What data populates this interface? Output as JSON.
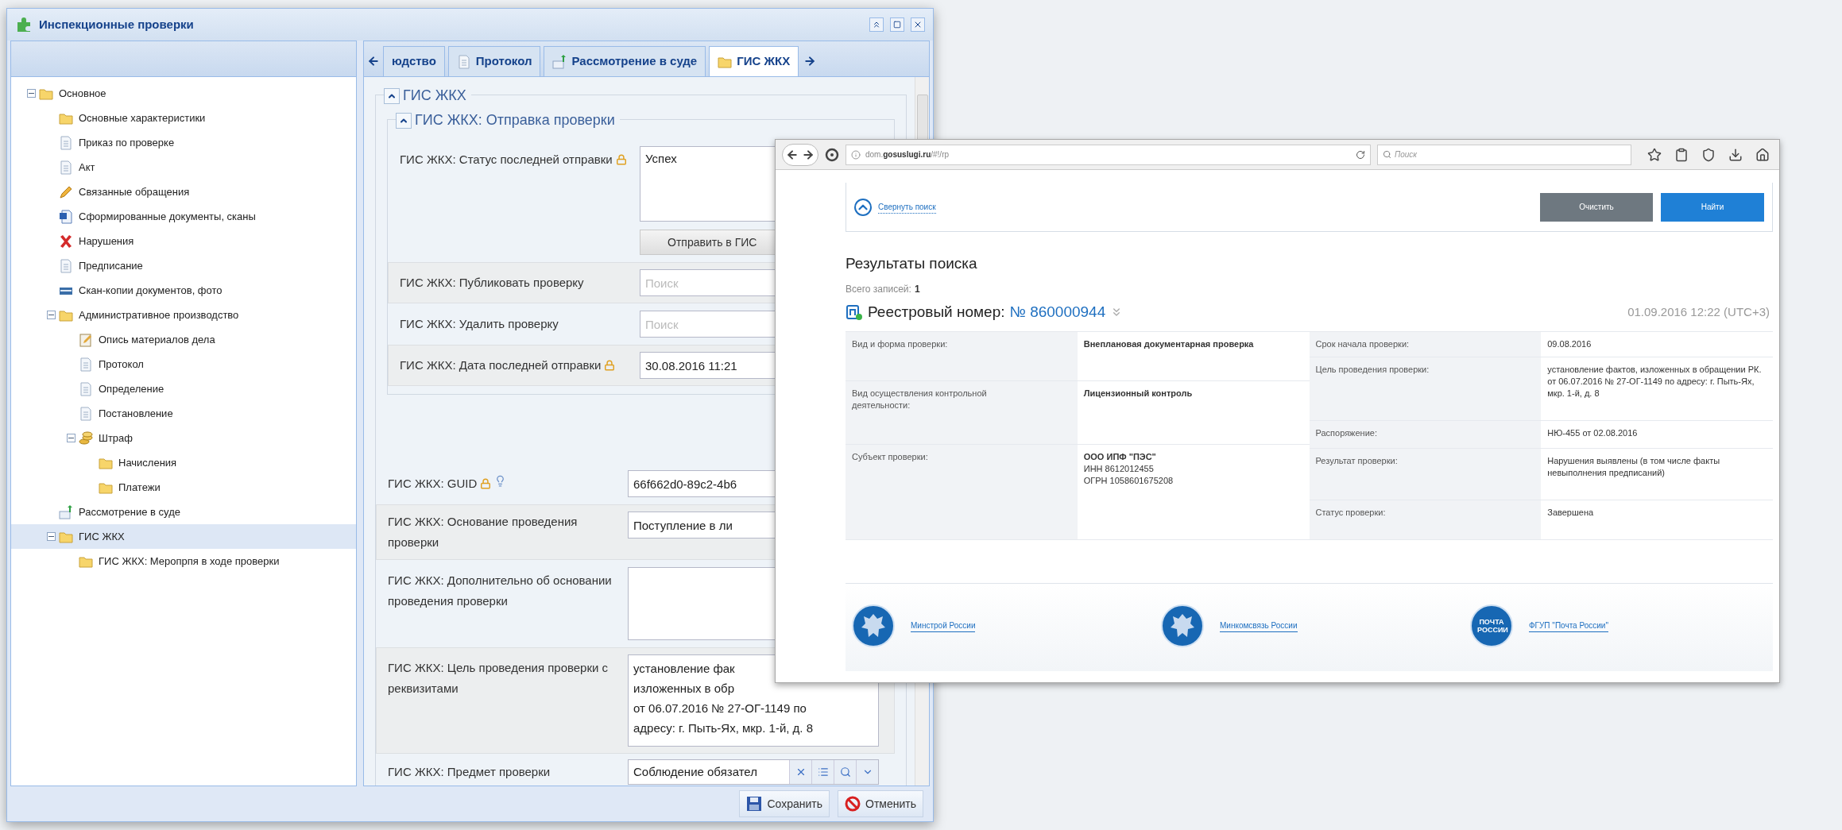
{
  "left_window": {
    "title": "Инспекционные проверки",
    "tree": [
      {
        "label": "Основное",
        "kind": "folder",
        "expanded": true,
        "selected": false,
        "children": [
          {
            "label": "Основные характеристики",
            "kind": "folder",
            "selected": false
          },
          {
            "label": "Приказ по проверке",
            "kind": "doc",
            "selected": false
          },
          {
            "label": "Акт",
            "kind": "doc",
            "selected": false
          },
          {
            "label": "Связанные обращения",
            "kind": "pencil",
            "selected": false
          },
          {
            "label": "Сформированные документы, сканы",
            "kind": "word",
            "selected": false
          },
          {
            "label": "Нарушения",
            "kind": "cross",
            "selected": false
          },
          {
            "label": "Предписание",
            "kind": "doc",
            "selected": false
          },
          {
            "label": "Скан-копии документов, фото",
            "kind": "scan",
            "selected": false
          },
          {
            "label": "Административное производство",
            "kind": "folder",
            "expanded": true,
            "selected": false,
            "children": [
              {
                "label": "Опись материалов дела",
                "kind": "edit",
                "selected": false
              },
              {
                "label": "Протокол",
                "kind": "doc",
                "selected": false
              },
              {
                "label": "Определение",
                "kind": "doc",
                "selected": false
              },
              {
                "label": "Постановление",
                "kind": "doc",
                "selected": false
              },
              {
                "label": "Штраф",
                "kind": "coins",
                "expanded": true,
                "selected": false,
                "children": [
                  {
                    "label": "Начисления",
                    "kind": "folder",
                    "selected": false
                  },
                  {
                    "label": "Платежи",
                    "kind": "folder",
                    "selected": false
                  }
                ]
              }
            ]
          },
          {
            "label": "Рассмотрение в суде",
            "kind": "upload",
            "selected": false
          },
          {
            "label": "ГИС ЖКХ",
            "kind": "folder",
            "expanded": true,
            "selected": true,
            "children": [
              {
                "label": "ГИС ЖКХ: Меропрпя в ходе проверки",
                "kind": "folder",
                "selected": false
              }
            ]
          }
        ]
      }
    ],
    "tabs": [
      {
        "label": "юдство",
        "kind": "plain",
        "selected": false
      },
      {
        "label": "Протокол",
        "kind": "doc",
        "selected": false
      },
      {
        "label": "Рассмотрение в суде",
        "kind": "upload",
        "selected": false
      },
      {
        "label": "ГИС ЖКХ",
        "kind": "folder",
        "selected": true
      }
    ],
    "section_title": "ГИС ЖКХ",
    "subsection_title": "ГИС ЖКХ: Отправка проверки",
    "subsection_fields": [
      {
        "label": "ГИС ЖКХ: Статус последней отправки",
        "locked": true,
        "hint": false,
        "kind": "textarea",
        "value": "Успех",
        "action": "Отправить в ГИС"
      },
      {
        "label": "ГИС ЖКХ: Публиковать проверку",
        "locked": false,
        "hint": false,
        "kind": "search",
        "placeholder": "Поиск"
      },
      {
        "label": "ГИС ЖКХ: Удалить проверку",
        "locked": false,
        "hint": false,
        "kind": "search",
        "placeholder": "Поиск"
      },
      {
        "label": "ГИС ЖКХ: Дата последней отправки",
        "locked": true,
        "hint": false,
        "kind": "text",
        "value": "30.08.2016 11:21"
      }
    ],
    "fields": [
      {
        "label": "ГИС ЖКХ: GUID",
        "locked": true,
        "hint": true,
        "kind": "text",
        "value": "66f662d0-89c2-4b6"
      },
      {
        "label": "ГИС ЖКХ: Основание проведения проверки",
        "locked": false,
        "hint": false,
        "kind": "text",
        "value": "Поступление в ли"
      },
      {
        "label": "ГИС ЖКХ: Дополнительно об основании проведения проверки",
        "locked": false,
        "hint": false,
        "kind": "textarea"
      },
      {
        "label": "ГИС ЖКХ: Цель проведения проверки с реквизитами",
        "locked": false,
        "hint": false,
        "kind": "lines",
        "lines": [
          "установление фак",
          "изложенных в обр",
          "от 06.07.2016 № 27-ОГ-1149 по",
          "адресу: г. Пыть-Ях, мкр. 1-й, д. 8"
        ]
      },
      {
        "label": "ГИС ЖКХ: Предмет проверки",
        "locked": false,
        "hint": false,
        "kind": "combo",
        "value": "Соблюдение обязател"
      }
    ],
    "buttons": [
      {
        "label": "Сохранить",
        "kind": "save"
      },
      {
        "label": "Отменить",
        "kind": "cancel"
      }
    ]
  },
  "browser": {
    "url_host": "dom.",
    "url_domain": "gosuslugi.ru",
    "url_path": "/#!/rp",
    "search_placeholder": "Поиск",
    "collapse_link": "Свернуть поиск",
    "clear_button": "Очистить",
    "find_button": "Найти",
    "results_title": "Результаты поиска",
    "total_label": "Всего записей:",
    "total_value": "1",
    "registry_label": "Реестровый номер:",
    "registry_number": "№ 860000944",
    "date": "01.09.2016 12:22 (UTC+3)",
    "details_left": [
      {
        "label": "Вид и форма проверки:",
        "lines": [
          "**Внеплановая документарная проверка**"
        ]
      },
      {
        "label": "Вид осуществления контрольной деятельности:",
        "lines": [
          "**Лицензионный контроль**"
        ]
      },
      {
        "label": "Субъект проверки:",
        "lines": [
          "**ООО ИПФ \"ПЭС\"**",
          "ИНН 8612012455",
          "ОГРН 1058601675208"
        ]
      }
    ],
    "details_right": [
      {
        "label": "Срок начала проверки:",
        "lines": [
          "09.08.2016"
        ]
      },
      {
        "label": "Цель проведения проверки:",
        "lines": [
          "установление фактов, изложенных в обращении РК. от 06.07.2016 № 27-ОГ-1149 по адресу: г. Пыть-Ях, мкр. 1-й, д. 8"
        ]
      },
      {
        "label": "Распоряжение:",
        "lines": [
          "НЮ-455 от 02.08.2016"
        ]
      },
      {
        "label": "Результат проверки:",
        "lines": [
          "Нарушения выявлены (в том числе факты невыполнения предписаний)"
        ]
      },
      {
        "label": "Статус проверки:",
        "lines": [
          "Завершена"
        ]
      }
    ],
    "footer": [
      {
        "label": "Минстрой России",
        "kind": "emblem"
      },
      {
        "label": "Минкомсвязь России",
        "kind": "emblem"
      },
      {
        "label": "ФГУП \"Почта России\"",
        "kind": "text",
        "logo_text": "ПОЧТА РОССИИ"
      }
    ]
  }
}
